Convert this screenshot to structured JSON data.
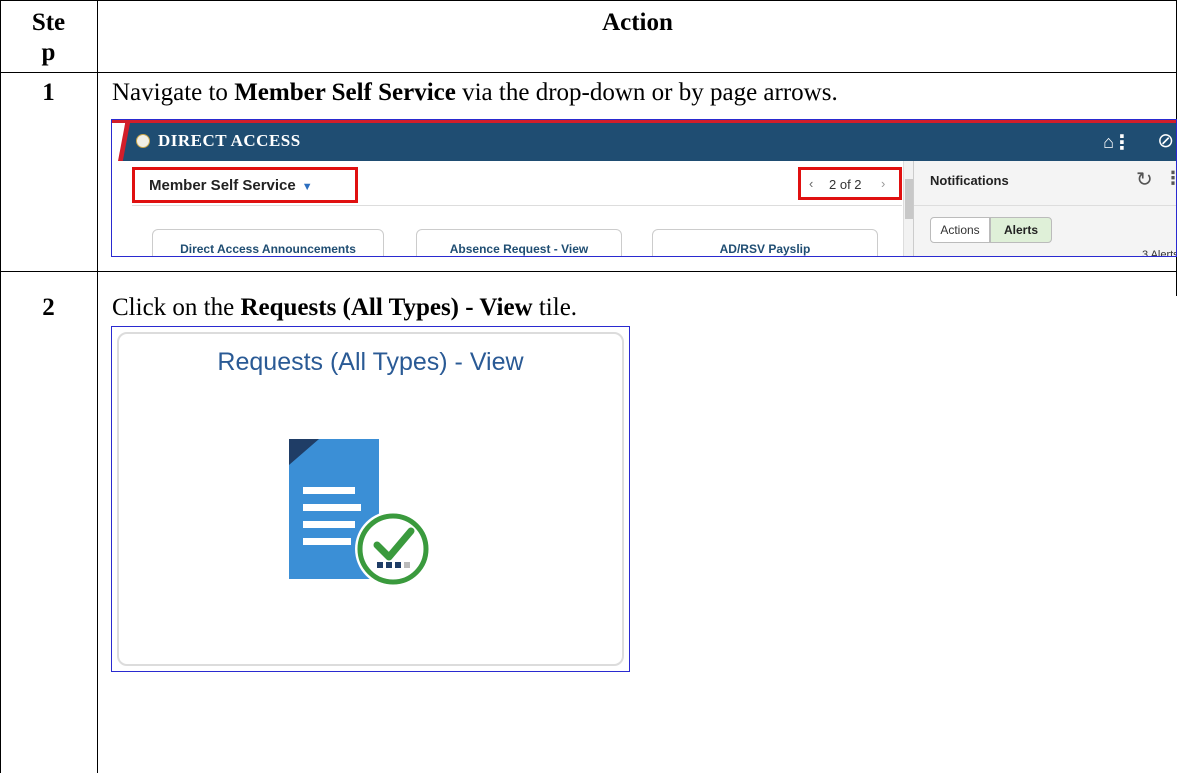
{
  "table": {
    "header_step": "Ste\np",
    "header_step_line1": "Ste",
    "header_step_line2": "p",
    "header_action": "Action"
  },
  "steps": [
    {
      "number": "1",
      "text_pre": "Navigate to ",
      "text_bold": "Member Self Service",
      "text_post": " via the drop-down or by page arrows."
    },
    {
      "number": "2",
      "text_pre": "Click on the ",
      "text_bold": "Requests (All Types) - View",
      "text_post": " tile."
    }
  ],
  "screenshot1": {
    "app_title": "DIRECT ACCESS",
    "homepage_selector": "Member Self Service",
    "pager": "2 of 2",
    "tiles": [
      "Direct Access Announcements",
      "Absence Request - View",
      "AD/RSV Payslip"
    ],
    "notifications": {
      "title": "Notifications",
      "segments": [
        "Actions",
        "Alerts"
      ],
      "active_segment": "Alerts",
      "count_text": "3 Alerts"
    },
    "icons": [
      "home-icon",
      "more-icon",
      "block-icon",
      "refresh-icon"
    ],
    "colors": {
      "banner": "#1f4d72",
      "accent_red": "#d21e2a",
      "highlight": "#e01010"
    }
  },
  "screenshot2": {
    "tile_title": "Requests (All Types) - View",
    "icon": "document-check-icon"
  }
}
